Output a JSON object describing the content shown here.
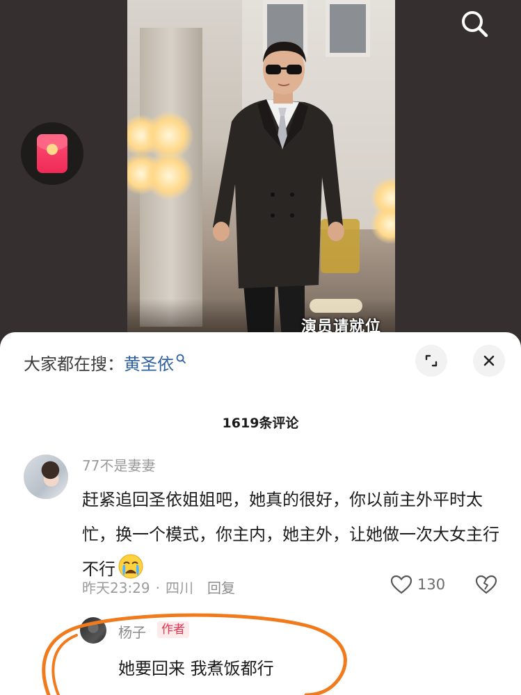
{
  "video": {
    "overlay_caption": "演员请就位",
    "search_icon": "search-icon",
    "red_packet_icon": "red-packet-icon"
  },
  "comment_sheet": {
    "search_prefix": "大家都在搜：",
    "search_keyword": "黄圣依",
    "expand_icon": "expand-icon",
    "close_icon": "close-icon",
    "comment_count": "1619条评论"
  },
  "comments": [
    {
      "username": "77不是妻妻",
      "text": "赶紧追回圣依姐姐吧，她真的很好，你以前主外平时太忙，换一个模式，你主内，她主外，让她做一次大女主行不行",
      "emoji": "crying-face-emoji",
      "time": "昨天23:29",
      "dot": "·",
      "location": "四川",
      "reply_label": "回复",
      "likes": "130",
      "reply": {
        "username": "杨子",
        "badge": "作者",
        "text": "她要回来 我煮饭都行"
      }
    }
  ],
  "colors": {
    "accent_keyword": "#2e5f9e",
    "author_badge_text": "#e8334f",
    "annotation_circle": "#f07a1c"
  }
}
